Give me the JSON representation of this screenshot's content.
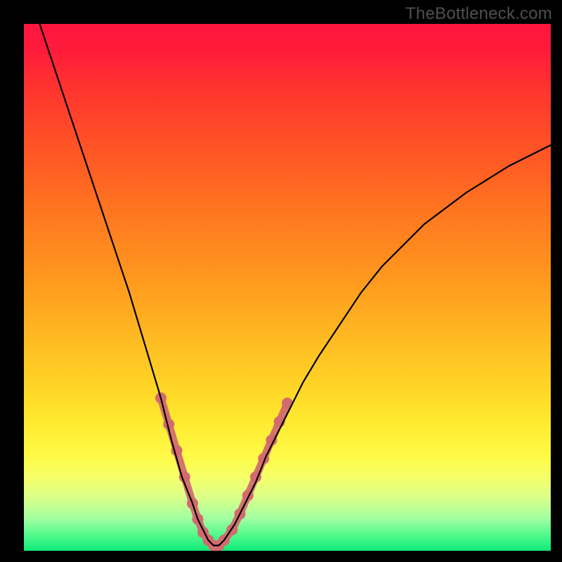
{
  "watermark": {
    "text": "TheBottleneck.com"
  },
  "colors": {
    "frame": "#000000",
    "curve": "#000000",
    "marker": "#d26a6e",
    "gradient_top": "#ff153e",
    "gradient_bottom": "#0fea7a"
  },
  "chart_data": {
    "type": "line",
    "title": "",
    "xlabel": "",
    "ylabel": "",
    "xlim": [
      0,
      100
    ],
    "ylim": [
      0,
      100
    ],
    "series": [
      {
        "name": "bottleneck-curve",
        "x": [
          3,
          5,
          8,
          11,
          14,
          17,
          20,
          23,
          26,
          28,
          30,
          32,
          33,
          34,
          35,
          36,
          37,
          38,
          40,
          42,
          44,
          46,
          48,
          50,
          53,
          56,
          60,
          64,
          68,
          72,
          76,
          80,
          84,
          88,
          92,
          96,
          100
        ],
        "values": [
          100,
          94,
          85,
          76,
          67,
          58,
          49,
          39,
          29,
          21,
          14,
          9,
          6,
          4,
          2,
          1,
          1,
          2,
          5,
          9,
          13,
          18,
          22,
          26,
          32,
          37,
          43,
          49,
          54,
          58,
          62,
          65,
          68,
          70.5,
          73,
          75,
          77
        ]
      }
    ],
    "markers": {
      "name": "highlighted-range",
      "x": [
        26,
        27.5,
        29,
        30.5,
        32,
        33,
        34,
        35,
        36,
        37,
        38,
        39.5,
        41,
        42.5,
        44,
        45.5,
        47,
        48.5,
        50
      ],
      "values": [
        29,
        24,
        19,
        14,
        9,
        6,
        3.5,
        2,
        1,
        1,
        2,
        4,
        7,
        10.5,
        14,
        17.5,
        21,
        24.5,
        28
      ]
    }
  }
}
